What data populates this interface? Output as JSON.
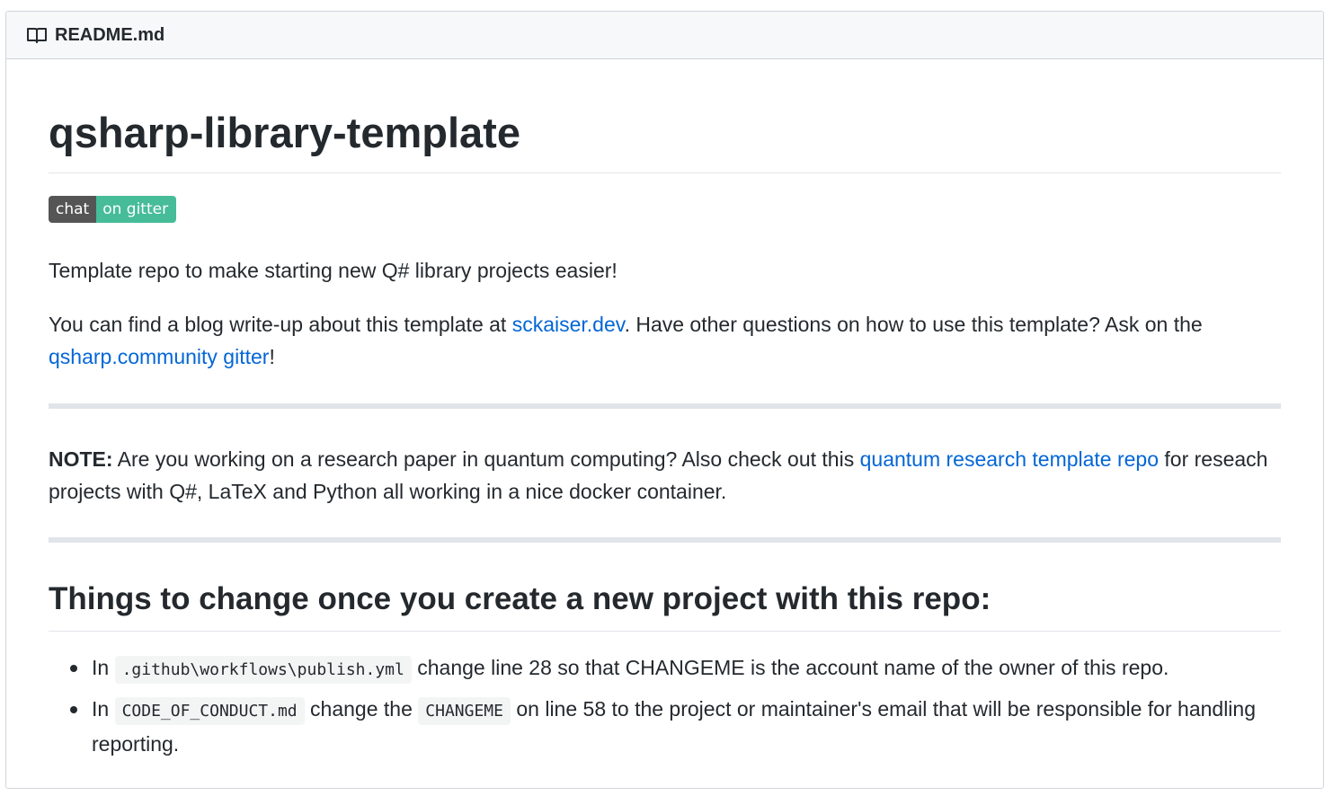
{
  "header": {
    "icon": "book-icon",
    "title": "README.md"
  },
  "readme": {
    "title": "qsharp-library-template",
    "badge": {
      "left": "chat",
      "right": "on gitter",
      "left_color": "#555555",
      "right_color": "#46bc99"
    },
    "intro": "Template repo to make starting new Q# library projects easier!",
    "blog": {
      "prefix": "You can find a blog write-up about this template at ",
      "link1": "sckaiser.dev",
      "middle": ". Have other questions on how to use this template? Ask on the ",
      "link2": "qsharp.community gitter",
      "suffix": "!"
    },
    "note": {
      "label": "NOTE:",
      "prefix": " Are you working on a research paper in quantum computing? Also check out this ",
      "link": "quantum research template repo",
      "suffix": " for reseach projects with Q#, LaTeX and Python all working in a nice docker container."
    },
    "section_title": "Things to change once you create a new project with this repo:",
    "items": [
      {
        "prefix": "In ",
        "code": ".github\\workflows\\publish.yml",
        "suffix": " change line 28 so that CHANGEME is the account name of the owner of this repo."
      },
      {
        "prefix": "In ",
        "code": "CODE_OF_CONDUCT.md",
        "middle": " change the ",
        "code2": "CHANGEME",
        "suffix": " on line 58 to the project or maintainer's email that will be responsible for handling reporting."
      }
    ]
  },
  "colors": {
    "link": "#0366d6",
    "text": "#24292e",
    "header_bg": "#f6f8fa"
  }
}
